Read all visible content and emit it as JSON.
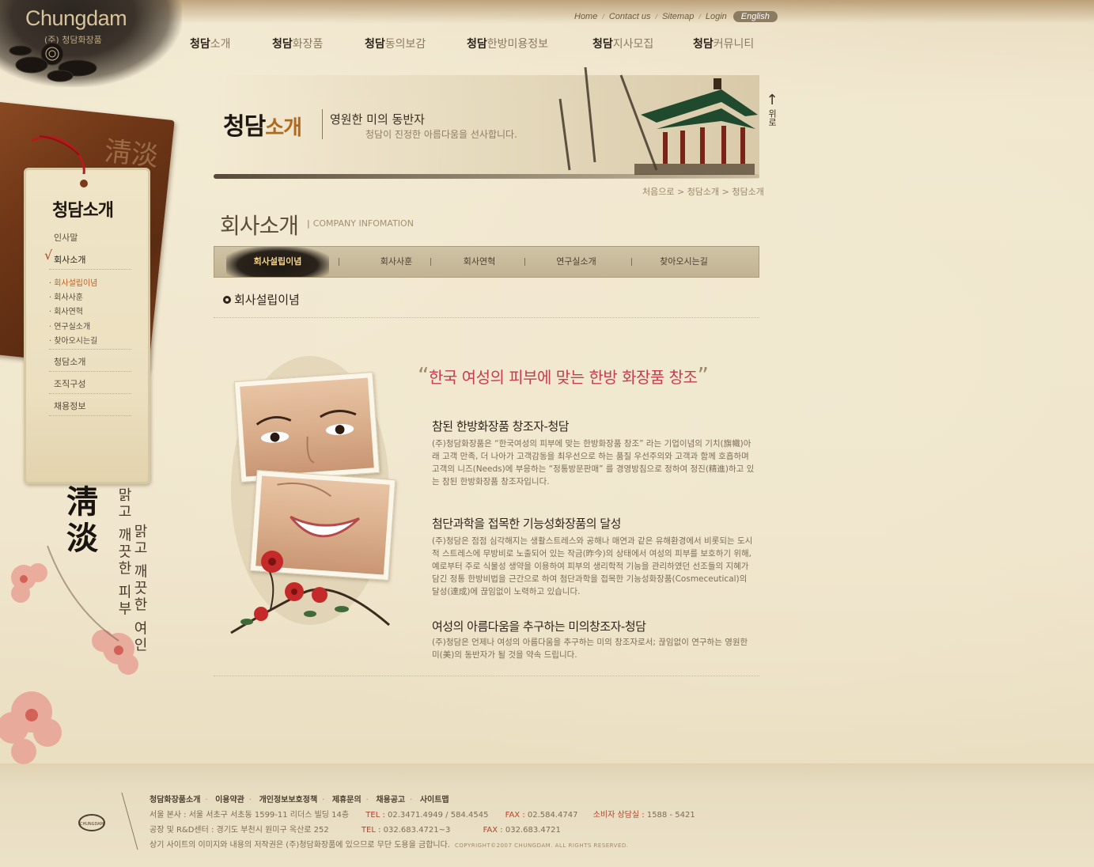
{
  "brand": {
    "logo": "Chungdam",
    "company": "(주) 청담화장품"
  },
  "util_nav": {
    "items": [
      "Home",
      "Contact us",
      "Sitemap",
      "Login"
    ],
    "language": "English"
  },
  "main_nav": [
    {
      "bold": "청담",
      "rest": "소개"
    },
    {
      "bold": "청담",
      "rest": "화장품"
    },
    {
      "bold": "청담",
      "rest": "동의보감"
    },
    {
      "bold": "청담",
      "rest": "한방미용정보"
    },
    {
      "bold": "청담",
      "rest": "지사모집"
    },
    {
      "bold": "청담",
      "rest": "커뮤니티"
    }
  ],
  "hero": {
    "title_bold": "청담",
    "title_accent": "소개",
    "tagline": "영원한 미의 동반자",
    "subtext": "청담이 진정한 아름다움을 선사합니다."
  },
  "to_top": {
    "arrow": "↑",
    "label": "위로"
  },
  "breadcrumb": "처음으로 > 청담소개 > 청담소개",
  "section": {
    "title": "회사소개",
    "english": "COMPANY INFOMATION"
  },
  "tabs": [
    "회사설립이념",
    "회사사훈",
    "회사연혁",
    "연구실소개",
    "찾아오시는길"
  ],
  "active_tab": 0,
  "sub_title": "회사설립이념",
  "sidebar": {
    "heading": "청담소개",
    "items": [
      {
        "label": "인사말"
      },
      {
        "label": "회사소개",
        "current": true
      }
    ],
    "sub_items": [
      "회사설립이념",
      "회사사훈",
      "회사연혁",
      "연구실소개",
      "찾아오시는길"
    ],
    "more_items": [
      "청담소개",
      "조직구성",
      "채용정보"
    ],
    "calligraphy": "淸淡",
    "vertical_left": "맑고 깨끗한 피부",
    "vertical_right": "맑고 깨끗한 여인",
    "book_hanja": "淸淡"
  },
  "content": {
    "quote": "한국 여성의 피부에 맞는 한방 화장품 창조",
    "blocks": [
      {
        "title": "참된 한방화장품 창조자-청담",
        "body": "(주)청담화장품은 “한국여성의 피부에 맞는 한방화장품 창조” 라는 기업이념의 기치(旗幟)아래 고객 만족, 더 나아가 고객감동을 최우선으로 하는 품질 우선주의와 고객과 함께 호흡하며 고객의 니즈(Needs)에 부응하는 “정통방문판매” 를 경영방침으로 정하여 정진(精進)하고 있는 참된 한방화장품 창조자입니다."
      },
      {
        "title": "첨단과학을 접목한 기능성화장품의 달성",
        "body": "(주)청담은 점점 심각해지는 생활스트레스와 공해나 매연과 같은 유해환경에서 비롯되는 도시적 스트레스에 무방비로 노출되어 있는 작금(昨今)의 상태에서 여성의 피부를 보호하기 위해, 예로부터 주로 식물성 생약을 이용하여 피부의 생리학적 기능을 관리하였던 선조들의 지혜가 담긴 정통 한방비법을 근간으로 하여 첨단과학을 접목한 기능성화장품(Cosmeceutical)의 달성(達成)에 끊임없이 노력하고 있습니다."
      },
      {
        "title": "여성의 아름다움을 추구하는 미의창조자-청담",
        "body": "(주)청담은 언제나 여성의 아름다움을 추구하는 미의 창조자로서; 끊임없이 연구하는 영원한 미(美)의 동반자가 될 것을 약속 드립니다."
      }
    ]
  },
  "footer": {
    "links": [
      "청담화장품소개",
      "이용약관",
      "개인정보보호정책",
      "제휴문의",
      "채용공고",
      "사이트맵"
    ],
    "hq": "서울 본사 : 서울 서초구 서초동 1599-11 리더스 빌딩 14층",
    "hq_tel_label": "TEL :",
    "hq_tel": "02.3471.4949 / 584.4545",
    "hq_fax_label": "FAX :",
    "hq_fax": "02.584.4747",
    "consumer_label": "소비자 상담실 :",
    "consumer": "1588 - 5421",
    "rnd": "공장 및 R&D센터 : 경기도 부천시 원미구 옥산로 252",
    "rnd_tel_label": "TEL :",
    "rnd_tel": "032.683.4721~3",
    "rnd_fax_label": "FAX :",
    "rnd_fax": "032.683.4721",
    "notice": "상기 사이트의 이미지와 내용의 저작권은 (주)청담화장품에 있으므로 무단 도용을 금합니다.",
    "copyright": "COPYRIGHT©2007 CHUNGDAM. ALL RIGHTS RESERVED.",
    "logo": "CHUNGDAM"
  },
  "colors": {
    "accent_red": "#c43e4e",
    "brown": "#6f3717",
    "orange": "#c55e22",
    "ink": "#2b2119"
  }
}
